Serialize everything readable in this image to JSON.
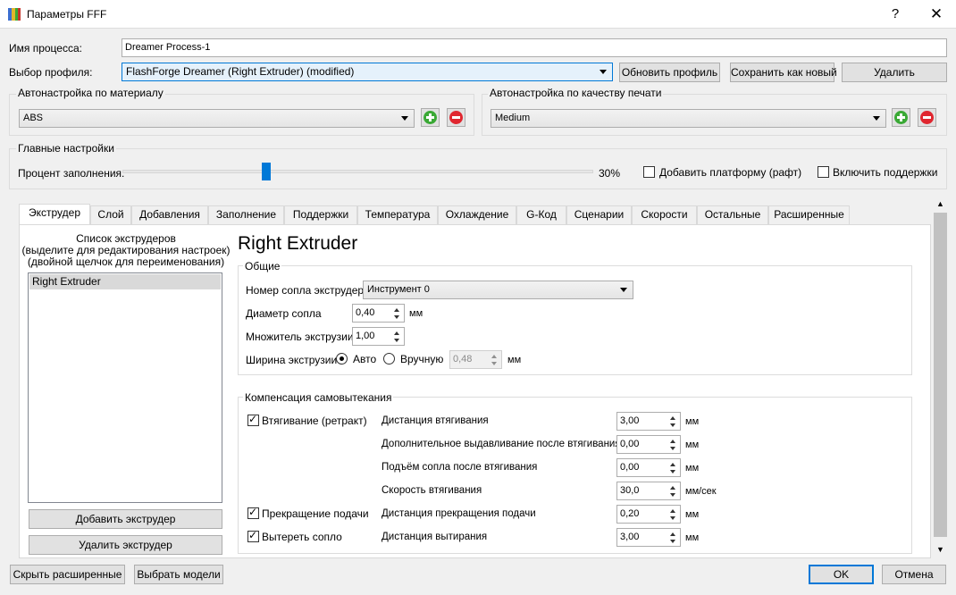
{
  "window": {
    "title": "Параметры FFF",
    "help_glyph": "?",
    "close_glyph": "✕"
  },
  "process": {
    "label": "Имя процесса:",
    "value": "Dreamer Process-1"
  },
  "profile": {
    "label": "Выбор профиля:",
    "value": "FlashForge Dreamer (Right Extruder) (modified)",
    "update_button": "Обновить профиль",
    "save_new_button": "Сохранить как новый",
    "delete_button": "Удалить"
  },
  "material": {
    "group_title": "Автонастройка по  материалу",
    "value": "ABS"
  },
  "quality": {
    "group_title": "Автонастройка по качеству печати",
    "value": "Medium"
  },
  "main_settings": {
    "group_title": "Главные настройки",
    "infill_label": "Процент заполнения:",
    "infill_value": "30%",
    "infill_fraction": 0.3,
    "raft_label": "Добавить платформу (рафт)",
    "raft_checked": false,
    "supports_label": "Включить поддержки",
    "supports_checked": false
  },
  "tabs": [
    "Экструдер",
    "Слой",
    "Добавления",
    "Заполнение",
    "Поддержки",
    "Температура",
    "Охлаждение",
    "G-Код",
    "Сценарии",
    "Скорости",
    "Остальные",
    "Расширенные"
  ],
  "extruder_list": {
    "caption_line1": "Список экструдеров",
    "caption_line2": "(выделите для редактирования настроек)",
    "caption_line3": "(двойной щелчок для переименования)",
    "items": [
      "Right Extruder"
    ],
    "add_button": "Добавить экструдер",
    "remove_button": "Удалить экструдер"
  },
  "extruder": {
    "heading": "Right Extruder",
    "general_title": "Общие",
    "nozzle_number_label": "Номер сопла экструдера",
    "nozzle_number_value": "Инструмент 0",
    "nozzle_diameter_label": "Диаметр сопла",
    "nozzle_diameter_value": "0,40",
    "extrusion_mult_label": "Множитель экструзии",
    "extrusion_mult_value": "1,00",
    "extrusion_width_label": "Ширина экструзии",
    "auto_label": "Авто",
    "manual_label": "Вручную",
    "extrusion_width_value": "0,48",
    "unit_mm": "мм",
    "unit_mm_s": "мм/сек"
  },
  "ooze": {
    "title": "Компенсация самовытекания",
    "retract_label": "Втягивание (ретракт)",
    "coast_label": "Прекращение подачи",
    "wipe_label": "Вытереть сопло",
    "rows": [
      {
        "label": "Дистанция втягивания",
        "value": "3,00",
        "unit": "мм"
      },
      {
        "label": "Дополнительное выдавливание после втягивания",
        "value": "0,00",
        "unit": "мм"
      },
      {
        "label": "Подъём сопла после втягивания",
        "value": "0,00",
        "unit": "мм"
      },
      {
        "label": "Скорость втягивания",
        "value": "30,0",
        "unit": "мм/сек"
      },
      {
        "label": "Дистанция прекращения подачи",
        "value": "0,20",
        "unit": "мм"
      },
      {
        "label": "Дистанция вытирания",
        "value": "3,00",
        "unit": "мм"
      }
    ]
  },
  "footer": {
    "hide_advanced": "Скрыть расширенные",
    "select_models": "Выбрать модели",
    "ok": "OK",
    "cancel": "Отмена"
  },
  "colors": {
    "accent": "#0078d7",
    "green": "#3aa935",
    "red": "#e0262f"
  }
}
